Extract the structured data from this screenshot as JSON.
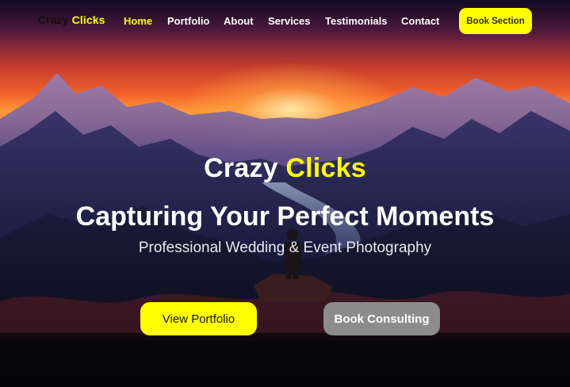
{
  "brand": {
    "word1": "Crazy",
    "word2": "Clicks"
  },
  "nav": {
    "items": [
      {
        "label": "Home",
        "active": true
      },
      {
        "label": "Portfolio",
        "active": false
      },
      {
        "label": "About",
        "active": false
      },
      {
        "label": "Services",
        "active": false
      },
      {
        "label": "Testimonials",
        "active": false
      },
      {
        "label": "Contact",
        "active": false
      }
    ],
    "cta_label": "Book Section"
  },
  "hero": {
    "brand_word1": "Crazy",
    "brand_word2": " Clicks",
    "heading": "Capturing Your Perfect Moments",
    "subheading": "Professional Wedding & Event Photography",
    "primary_button": "View Portfolio",
    "secondary_button": "Book Consulting",
    "background": "mountain-sunset-photo"
  },
  "colors": {
    "accent": "#ffff00",
    "secondary_button": "#8c8c8c",
    "text_light": "#ffffff"
  }
}
